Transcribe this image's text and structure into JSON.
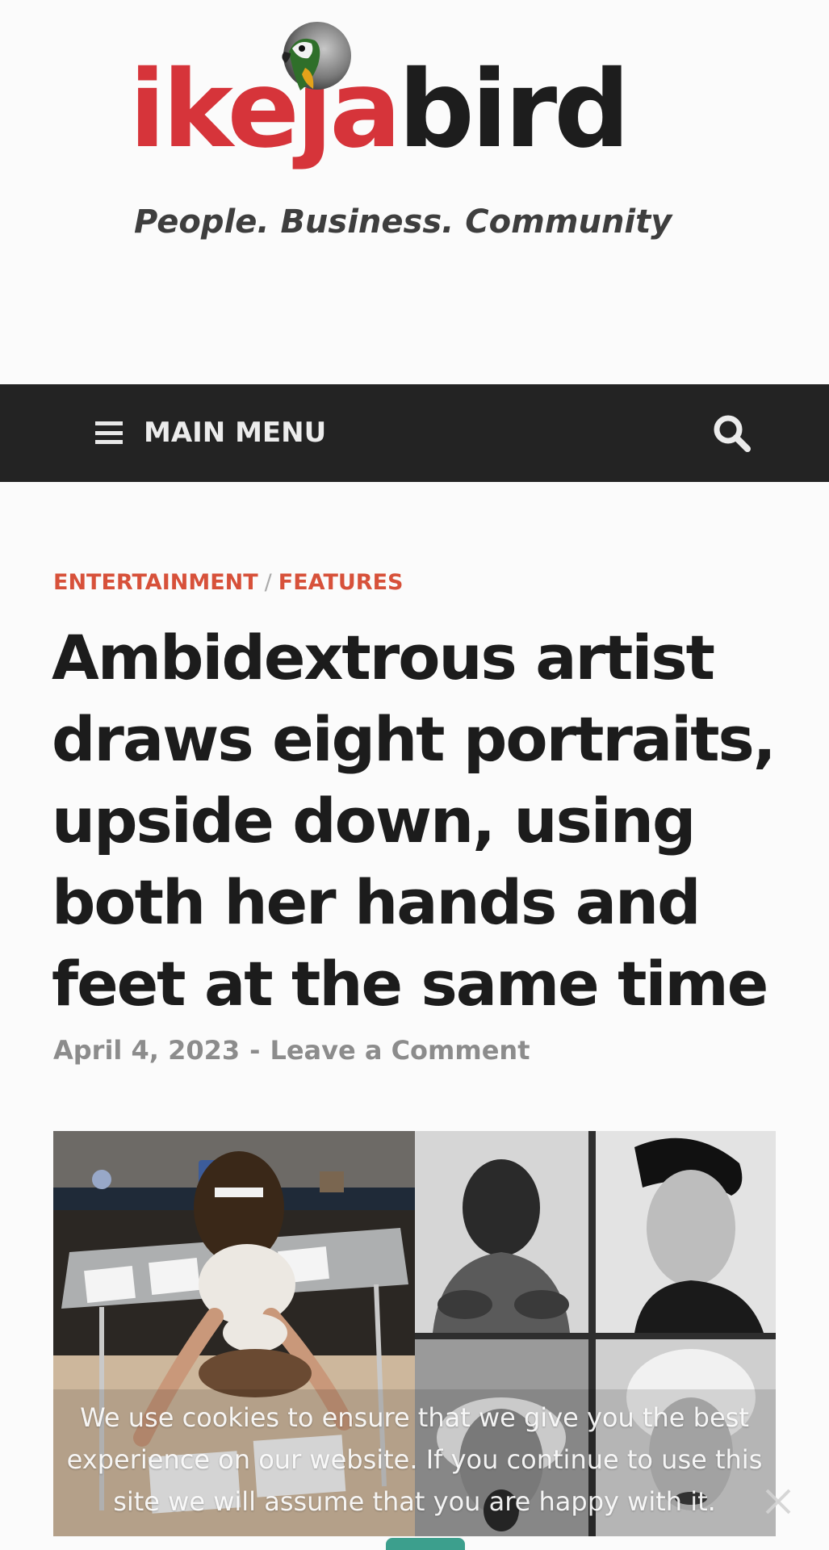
{
  "branding": {
    "logo_red_text": "ikeja",
    "logo_black_text": "bird",
    "tagline": "People. Business. Community",
    "accent_red": "#d6343a",
    "logo_black": "#1d1d1d"
  },
  "nav": {
    "menu_label": "MAIN MENU",
    "menu_icon": "hamburger-icon",
    "search_icon": "search-icon",
    "bar_color": "#232323"
  },
  "article": {
    "categories": [
      "ENTERTAINMENT",
      "FEATURES"
    ],
    "category_separator": "/",
    "category_color": "#d7513a",
    "title": "Ambidextrous artist draws eight portraits, upside down, using both her hands and feet at the same time",
    "date": "April 4, 2023",
    "meta_separator": "-",
    "comment_link": "Leave a Comment"
  },
  "cookie_notice": {
    "message": "We use cookies to ensure that we give you the best experience on our website. If you continue to use this site we will assume that you are happy with it.",
    "close_icon": "close-icon",
    "accept_color": "#3c9f8d"
  }
}
